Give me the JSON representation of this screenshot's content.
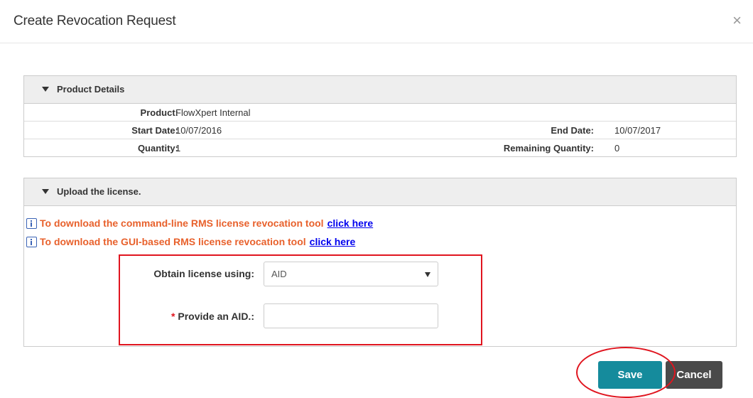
{
  "dialog": {
    "title": "Create Revocation Request",
    "close_icon": "×"
  },
  "product_details": {
    "header": "Product Details",
    "product_label": "Product:",
    "product_value": "FlowXpert Internal",
    "start_label": "Start Date:",
    "start_value": "10/07/2016",
    "end_label": "End Date:",
    "end_value": "10/07/2017",
    "quantity_label": "Quantity:",
    "quantity_value": "1",
    "remaining_label": "Remaining Quantity:",
    "remaining_value": "0"
  },
  "upload": {
    "header": "Upload the license.",
    "link1_text": "To download the command-line RMS license revocation tool",
    "link2_text": "To download the GUI-based RMS license revocation tool",
    "link_label": "click here",
    "obtain_label": "Obtain license using:",
    "obtain_value": "AID",
    "aid_required_mark": "*",
    "aid_label": "Provide an AID.:",
    "aid_value": ""
  },
  "buttons": {
    "save": "Save",
    "cancel": "Cancel"
  },
  "colors": {
    "save_bg": "#158b9c",
    "cancel_bg": "#4a4a4a",
    "info_text": "#e8612c",
    "highlight": "#e0151f"
  },
  "icons": {
    "close": "close-icon",
    "expand": "triangle-down-icon",
    "info": "info-icon",
    "dropdown": "dropdown-arrow-icon"
  }
}
